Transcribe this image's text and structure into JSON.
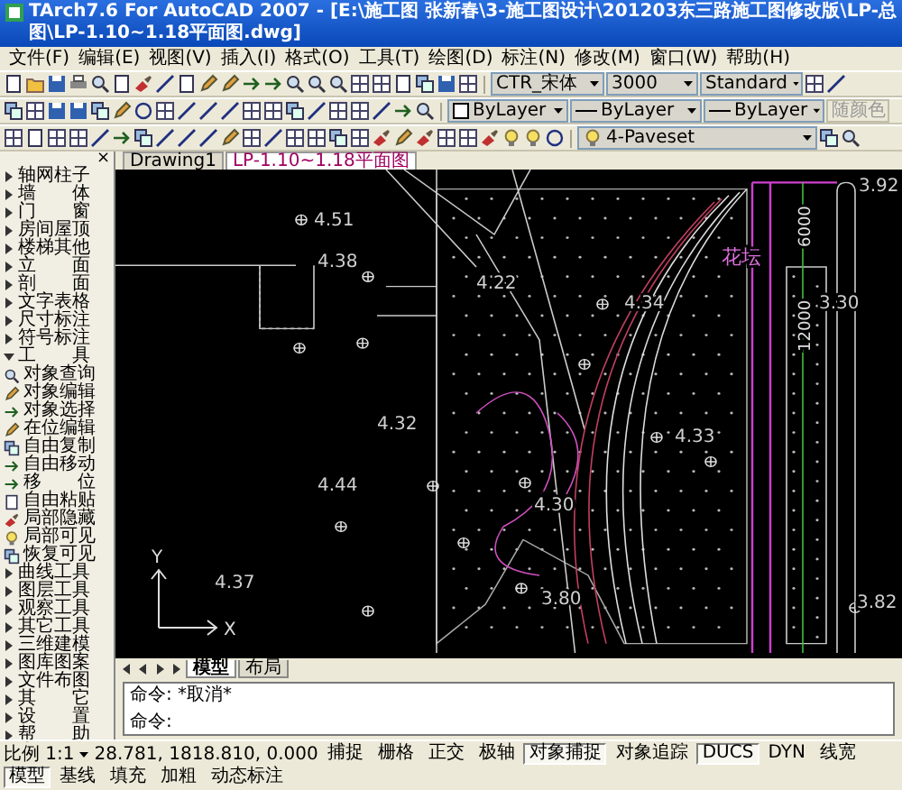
{
  "window": {
    "title": "TArch7.6 For AutoCAD 2007 - [E:\\施工图 张新春\\3-施工图设计\\201203东三路施工图修改版\\LP-总图\\LP-1.10~1.18平面图.dwg]"
  },
  "menu": [
    "文件(F)",
    "编辑(E)",
    "视图(V)",
    "插入(I)",
    "格式(O)",
    "工具(T)",
    "绘图(D)",
    "标注(N)",
    "修改(M)",
    "窗口(W)",
    "帮助(H)"
  ],
  "toolbars": {
    "text_style": "CTR_宋体",
    "dim_style": "3000",
    "table_style": "Standard",
    "color_setting": "ByLayer",
    "linetype": "ByLayer",
    "lineweight": "ByLayer",
    "plot_style": {
      "value": "随颜色",
      "disabled": true
    },
    "layer": "4-Paveset"
  },
  "document_tabs": [
    {
      "label": "Drawing1",
      "selected": false
    },
    {
      "label": "LP-1.10~1.18平面图",
      "selected": true
    }
  ],
  "sidebar": {
    "close": "×",
    "items": [
      {
        "label": "轴网柱子",
        "kind": "group",
        "expanded": false
      },
      {
        "label": "墙　　体",
        "kind": "group",
        "expanded": false
      },
      {
        "label": "门　　窗",
        "kind": "group",
        "expanded": false
      },
      {
        "label": "房间屋顶",
        "kind": "group",
        "expanded": false
      },
      {
        "label": "楼梯其他",
        "kind": "group",
        "expanded": false
      },
      {
        "label": "立　　面",
        "kind": "group",
        "expanded": false
      },
      {
        "label": "剖　　面",
        "kind": "group",
        "expanded": false
      },
      {
        "label": "文字表格",
        "kind": "group",
        "expanded": false
      },
      {
        "label": "尺寸标注",
        "kind": "group",
        "expanded": false
      },
      {
        "label": "符号标注",
        "kind": "group",
        "expanded": false
      },
      {
        "label": "工　　具",
        "kind": "group",
        "expanded": true,
        "children": [
          {
            "label": "对象查询",
            "kind": "command"
          },
          {
            "label": "对象编辑",
            "kind": "command"
          },
          {
            "label": "对象选择",
            "kind": "command"
          },
          {
            "label": "在位编辑",
            "kind": "command"
          },
          {
            "label": "自由复制",
            "kind": "command"
          },
          {
            "label": "自由移动",
            "kind": "command"
          },
          {
            "label": "移　　位",
            "kind": "command"
          },
          {
            "label": "自由粘贴",
            "kind": "command"
          },
          {
            "label": "局部隐藏",
            "kind": "command"
          },
          {
            "label": "局部可见",
            "kind": "command"
          },
          {
            "label": "恢复可见",
            "kind": "command"
          },
          {
            "label": "曲线工具",
            "kind": "group",
            "expanded": false
          },
          {
            "label": "图层工具",
            "kind": "group",
            "expanded": false
          },
          {
            "label": "观察工具",
            "kind": "group",
            "expanded": false
          },
          {
            "label": "其它工具",
            "kind": "group",
            "expanded": false
          }
        ]
      },
      {
        "label": "三维建模",
        "kind": "group",
        "expanded": false
      },
      {
        "label": "图库图案",
        "kind": "group",
        "expanded": false
      },
      {
        "label": "文件布图",
        "kind": "group",
        "expanded": false
      },
      {
        "label": "其　　它",
        "kind": "group",
        "expanded": false
      },
      {
        "label": "设　　置",
        "kind": "group",
        "expanded": false
      },
      {
        "label": "帮　　助",
        "kind": "group",
        "expanded": false
      }
    ]
  },
  "drawing": {
    "labels": [
      {
        "text": "4.51",
        "kind": "elevation"
      },
      {
        "text": "4.38",
        "kind": "elevation"
      },
      {
        "text": "4.22",
        "kind": "elevation"
      },
      {
        "text": "4.34",
        "kind": "elevation"
      },
      {
        "text": "花坛",
        "kind": "note"
      },
      {
        "text": "3.92",
        "kind": "elevation"
      },
      {
        "text": "3.30",
        "kind": "elevation"
      },
      {
        "text": "4.32",
        "kind": "elevation"
      },
      {
        "text": "4.33",
        "kind": "elevation"
      },
      {
        "text": "4.44",
        "kind": "elevation"
      },
      {
        "text": "4.30",
        "kind": "elevation"
      },
      {
        "text": "3.80",
        "kind": "elevation"
      },
      {
        "text": "4.37",
        "kind": "elevation"
      },
      {
        "text": "3.82",
        "kind": "elevation"
      },
      {
        "text": "6000",
        "kind": "dimension"
      },
      {
        "text": "12000",
        "kind": "dimension"
      }
    ],
    "ucs": [
      "X",
      "Y"
    ]
  },
  "layout_tabs": [
    {
      "label": "模型",
      "selected": true
    },
    {
      "label": "布局",
      "selected": false
    }
  ],
  "command_lines": [
    "命令: *取消*",
    "命令:"
  ],
  "status_bar": {
    "scale": "比例 1:1",
    "coordinates": "28.781, 1818.810, 0.000",
    "buttons": [
      {
        "label": "捕捉",
        "on": false
      },
      {
        "label": "栅格",
        "on": false
      },
      {
        "label": "正交",
        "on": false
      },
      {
        "label": "极轴",
        "on": false
      },
      {
        "label": "对象捕捉",
        "on": true
      },
      {
        "label": "对象追踪",
        "on": false
      },
      {
        "label": "DUCS",
        "on": true
      },
      {
        "label": "DYN",
        "on": false
      },
      {
        "label": "线宽",
        "on": false
      },
      {
        "label": "模型",
        "on": true
      },
      {
        "label": "基线",
        "on": false
      },
      {
        "label": "填充",
        "on": false
      },
      {
        "label": "加粗",
        "on": false
      },
      {
        "label": "动态标注",
        "on": false
      }
    ]
  }
}
